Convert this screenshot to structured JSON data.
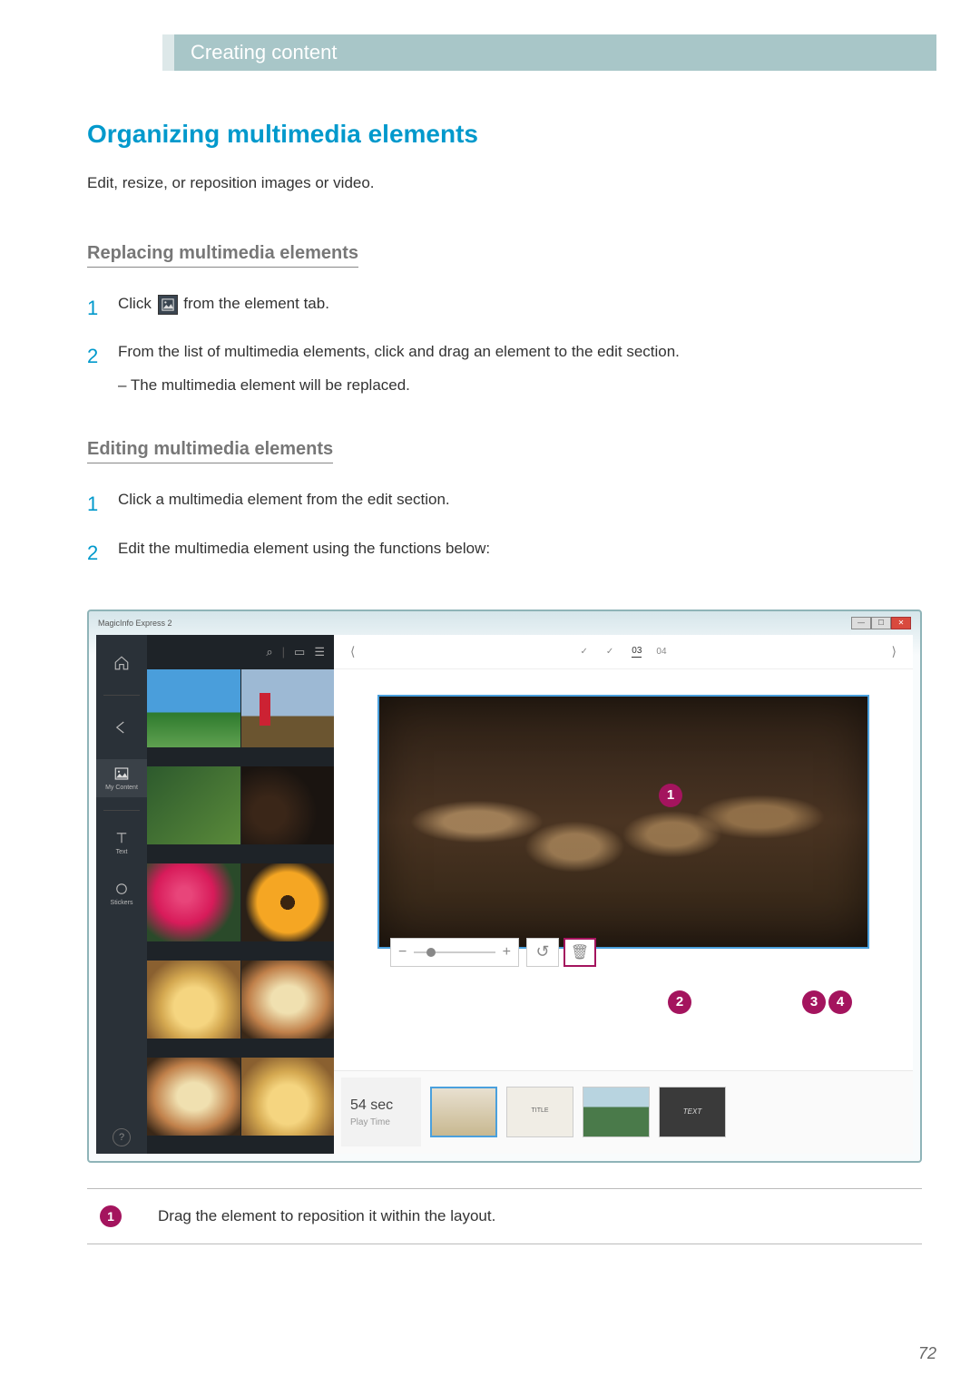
{
  "header": {
    "breadcrumb": "Creating content"
  },
  "title": "Organizing multimedia elements",
  "intro": "Edit, resize, or reposition images or video.",
  "section1": {
    "heading": "Replacing multimedia elements",
    "steps": [
      {
        "num": "1",
        "pre": "Click ",
        "post": " from the element tab."
      },
      {
        "num": "2",
        "text": "From the list of multimedia elements, click and drag an element to the edit section.",
        "sub": "The multimedia element will be replaced."
      }
    ]
  },
  "section2": {
    "heading": "Editing multimedia elements",
    "steps": [
      {
        "num": "1",
        "text": "Click a multimedia element from the edit section."
      },
      {
        "num": "2",
        "text": "Edit the multimedia element using the functions below:"
      }
    ]
  },
  "screenshot": {
    "app_title": "MagicInfo Express 2",
    "win_buttons": {
      "min": "—",
      "max": "☐",
      "close": "✕"
    },
    "sidebar": {
      "home": "",
      "back": "",
      "mycontent": "My Content",
      "text": "Text",
      "stickers": "Stickers",
      "help": "?"
    },
    "gallery_toolbar": {
      "search": "⌕",
      "sep": "|",
      "folder": "▭",
      "list": "☰"
    },
    "edit_toolbar": {
      "prev": "⟨",
      "next": "⟩",
      "pages": {
        "p1_chk": "",
        "p2_chk": "",
        "current": "03",
        "p4": "04"
      }
    },
    "callouts": {
      "c1": "1",
      "c2": "2",
      "c3": "3",
      "c4": "4"
    },
    "zoom": {
      "minus": "−",
      "plus": "+"
    },
    "rotate_icon": "↺",
    "trash_icon": "🗑",
    "playtime": {
      "value": "54 sec",
      "label": "Play Time"
    }
  },
  "desc_table": {
    "rows": [
      {
        "badge": "1",
        "text": "Drag the element to reposition it within the layout."
      }
    ]
  },
  "page_number": "72"
}
